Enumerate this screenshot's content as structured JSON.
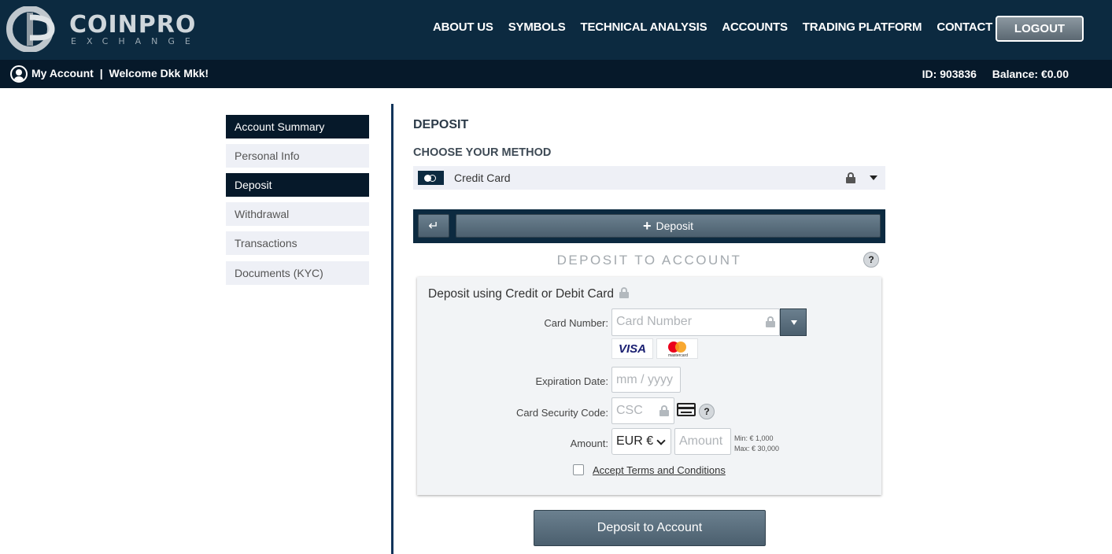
{
  "header": {
    "logo_text": "COINPRO",
    "logo_sub": "EXCHANGE",
    "nav": [
      "ABOUT US",
      "SYMBOLS",
      "TECHNICAL ANALYSIS",
      "ACCOUNTS",
      "TRADING PLATFORM",
      "CONTACT US"
    ],
    "logout_label": "LOGOUT"
  },
  "subbar": {
    "my_account": "My Account",
    "separator": "|",
    "welcome": "Welcome Dkk Mkk!",
    "id_label": "ID:",
    "id_value": "903836",
    "balance_label": "Balance:",
    "balance_value": "€0.00"
  },
  "sidebar": {
    "items": [
      {
        "label": "Account Summary",
        "active": true
      },
      {
        "label": "Personal Info",
        "active": false
      },
      {
        "label": "Deposit",
        "active": true
      },
      {
        "label": "Withdrawal",
        "active": false
      },
      {
        "label": "Transactions",
        "active": false
      },
      {
        "label": "Documents (KYC)",
        "active": false
      }
    ]
  },
  "main": {
    "title": "DEPOSIT",
    "choose_method": "CHOOSE YOUR METHOD",
    "method_selected": "Credit Card",
    "back_symbol": "↵",
    "deposit_tab_plus": "+",
    "deposit_tab_label": "Deposit",
    "section_title": "DEPOSIT TO ACCOUNT",
    "help": "?"
  },
  "form": {
    "title": "Deposit using Credit or Debit Card",
    "card_number_label": "Card Number:",
    "card_number_placeholder": "Card Number",
    "visa": "VISA",
    "mastercard_text": "mastercard",
    "expiration_label": "Expiration Date:",
    "expiration_placeholder": "mm / yyyy",
    "csc_label": "Card Security Code:",
    "csc_placeholder": "CSC",
    "amount_label": "Amount:",
    "currency_selected": "EUR €",
    "amount_placeholder": "Amount",
    "min_text": "Min: € 1,000",
    "max_text": "Max: € 30,000",
    "terms_label": "Accept Terms and Conditions"
  },
  "submit_label": "Deposit to Account",
  "colors": {
    "header_bg": "#0c2a40",
    "subbar_bg": "#06192a",
    "button_bg": "#5b6e7d"
  }
}
